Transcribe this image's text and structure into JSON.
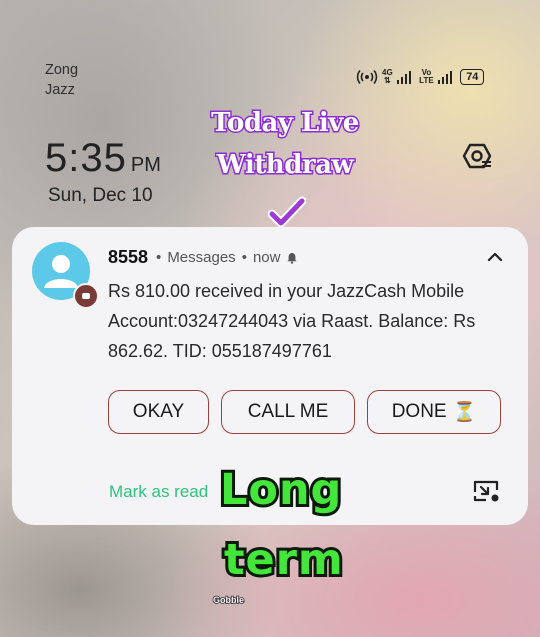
{
  "status_bar": {
    "carrier_1": "Zong",
    "carrier_2": "Jazz",
    "net_4g": "4G",
    "volte_top": "Vo",
    "volte_bottom": "LTE",
    "battery": "74"
  },
  "lockscreen": {
    "time": "5:35",
    "ampm": "PM",
    "date": "Sun, Dec 10"
  },
  "overlay": {
    "line_1": "Today Live",
    "line_2": "Withdraw",
    "sticker_1": "Long",
    "sticker_2": "term",
    "watermark": "Gobble"
  },
  "notification": {
    "sender": "8558",
    "app": "Messages",
    "time": "now",
    "message": "Rs 810.00 received in your JazzCash Mobile Account:03247244043 via Raast. Balance: Rs 862.62. TID: 055187497761",
    "actions": {
      "okay": "OKAY",
      "call_me": "CALL ME",
      "done": "DONE",
      "done_emoji": "⏳"
    },
    "mark_as_read": "Mark as read"
  },
  "colors": {
    "avatar": "#5dc9e8",
    "button_border": "#9b4141",
    "mark_read": "#2ec27e",
    "title_stroke": "#8b2fd3",
    "sticker_green": "#44e63b"
  },
  "icons": [
    "hotspot-icon",
    "signal-icon",
    "battery-icon",
    "eye-icon",
    "check-icon",
    "person-icon",
    "message-badge-icon",
    "bell-icon",
    "chevron-up-icon",
    "hourglass-icon",
    "snooze-icon"
  ]
}
